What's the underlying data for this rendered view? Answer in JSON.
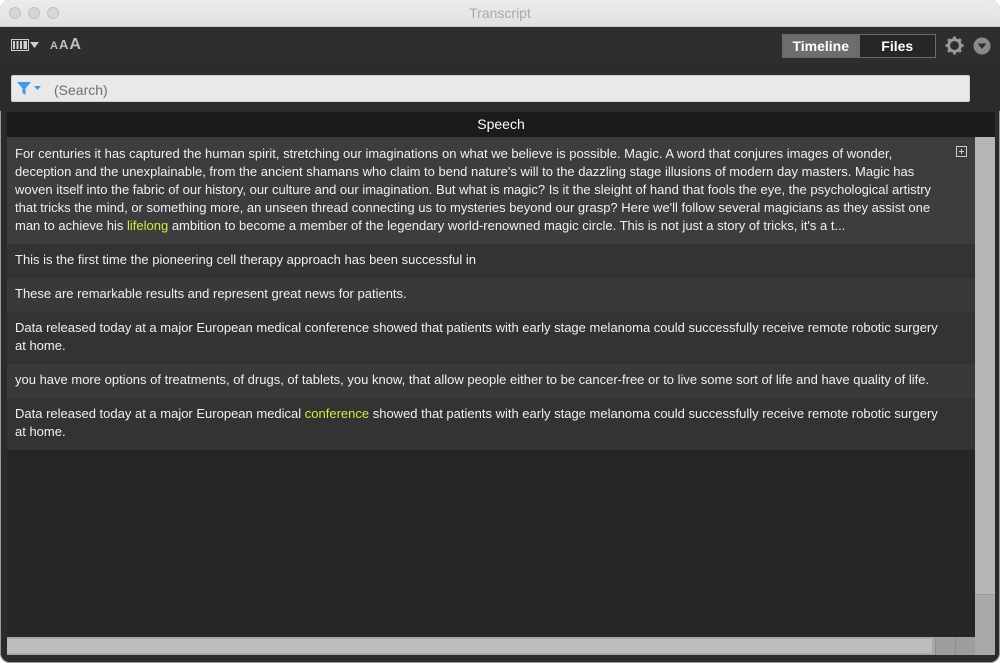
{
  "window": {
    "title": "Transcript"
  },
  "toolbar": {
    "font_sizes": [
      "A",
      "A",
      "A"
    ],
    "tabs": [
      {
        "label": "Timeline",
        "active": true
      },
      {
        "label": "Files",
        "active": false
      }
    ],
    "icons": [
      "columns-icon",
      "chevron-down-icon",
      "gear-icon",
      "dropdown-menu-icon"
    ]
  },
  "search": {
    "placeholder": "(Search)",
    "value": ""
  },
  "table": {
    "column_header": "Speech",
    "rows": [
      {
        "parts": [
          "For centuries it has captured the human spirit, stretching our imaginations on what we believe is possible. Magic. A word that conjures images of wonder, deception and the unexplainable, from the ancient shamans who claim to bend nature's will to the dazzling stage illusions of modern day masters. Magic has woven itself into the fabric of our history, our culture and our imagination. But what is magic? Is it the sleight of hand that fools the eye, the psychological artistry that tricks the mind, or something more, an unseen thread connecting us to mysteries beyond our grasp? Here we'll follow several magicians as they assist one man to achieve his ",
          "lifelong",
          " ambition to become a member of the legendary world-renowned magic circle. This is not just a story of tricks, it's a t..."
        ]
      },
      {
        "parts": [
          "This is the first time the pioneering cell therapy approach has been successful in"
        ]
      },
      {
        "parts": [
          "These are remarkable results and represent great news for patients."
        ]
      },
      {
        "parts": [
          "Data released today at a major European medical conference showed that patients with early stage melanoma could successfully receive remote robotic surgery at home."
        ]
      },
      {
        "parts": [
          "you have more options of treatments, of drugs, of tablets, you know, that allow people either to be cancer-free or to live some sort of life and have quality of life."
        ]
      },
      {
        "parts": [
          "Data released today at a major European medical ",
          "conference",
          " showed that patients with early stage melanoma could successfully receive remote robotic surgery at home."
        ]
      }
    ]
  },
  "colors": {
    "highlight": "#c6f03a",
    "background": "#2b2b2b",
    "filter_icon": "#3d9be9"
  }
}
